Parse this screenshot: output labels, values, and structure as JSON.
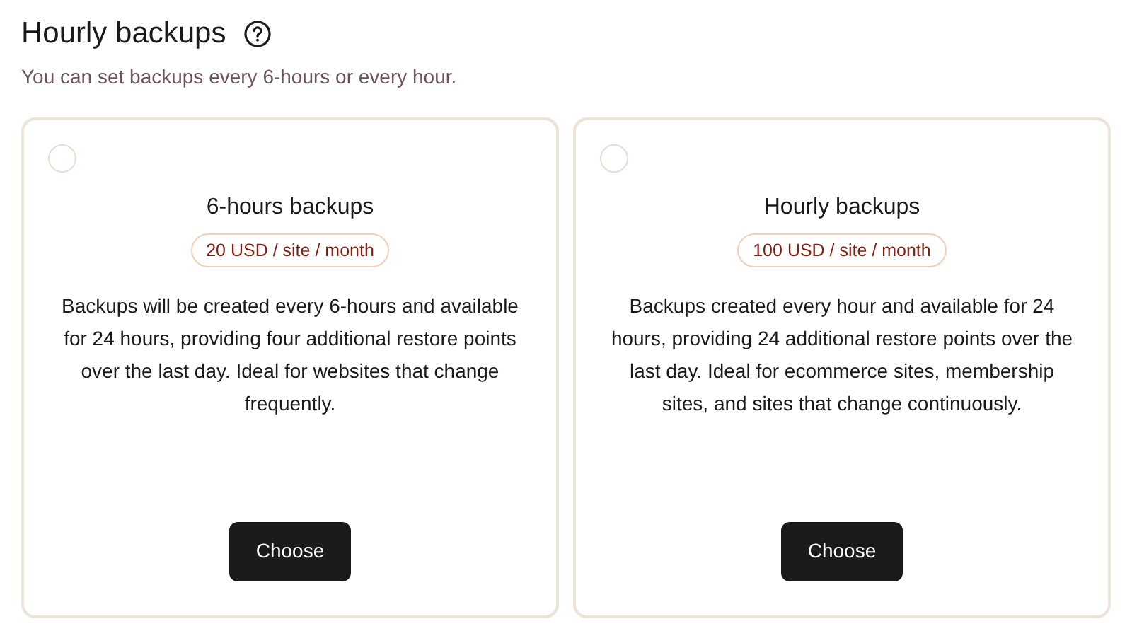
{
  "header": {
    "title": "Hourly backups",
    "subtitle": "You can set backups every 6-hours or every hour."
  },
  "plans": [
    {
      "selected": false,
      "title": "6-hours backups",
      "price": "20 USD / site / month",
      "description": "Backups will be created every 6-hours and available for 24 hours, providing four additional restore points over the last day. Ideal for websites that change frequently.",
      "button": "Choose"
    },
    {
      "selected": false,
      "title": "Hourly backups",
      "price": "100 USD / site / month",
      "description": "Backups created every hour and available for 24 hours, providing 24 additional restore points over the last day. Ideal for ecommerce sites, membership sites, and sites that change continuously.",
      "button": "Choose"
    }
  ]
}
